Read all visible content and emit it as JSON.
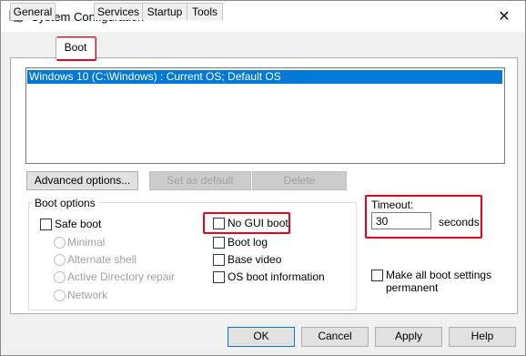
{
  "window": {
    "title": "System Configuration"
  },
  "tabs": [
    "General",
    "Boot",
    "Services",
    "Startup",
    "Tools"
  ],
  "os_list": {
    "items": [
      "Windows 10 (C:\\Windows) : Current OS; Default OS"
    ]
  },
  "buttons": {
    "advanced": "Advanced options...",
    "set_default": "Set as default",
    "delete": "Delete",
    "ok": "OK",
    "cancel": "Cancel",
    "apply": "Apply",
    "help": "Help"
  },
  "boot_options": {
    "label": "Boot options",
    "safe_boot": "Safe boot",
    "minimal": "Minimal",
    "alternate_shell": "Alternate shell",
    "active_directory": "Active Directory repair",
    "network": "Network",
    "no_gui_boot": "No GUI boot",
    "boot_log": "Boot log",
    "base_video": "Base video",
    "os_boot_info": "OS boot information"
  },
  "timeout": {
    "label": "Timeout:",
    "value": "30",
    "unit": "seconds"
  },
  "permanent": {
    "line1": "Make all boot settings",
    "line2": "permanent"
  },
  "colors": {
    "selection": "#0078d7",
    "highlight_border": "#e8001c"
  }
}
